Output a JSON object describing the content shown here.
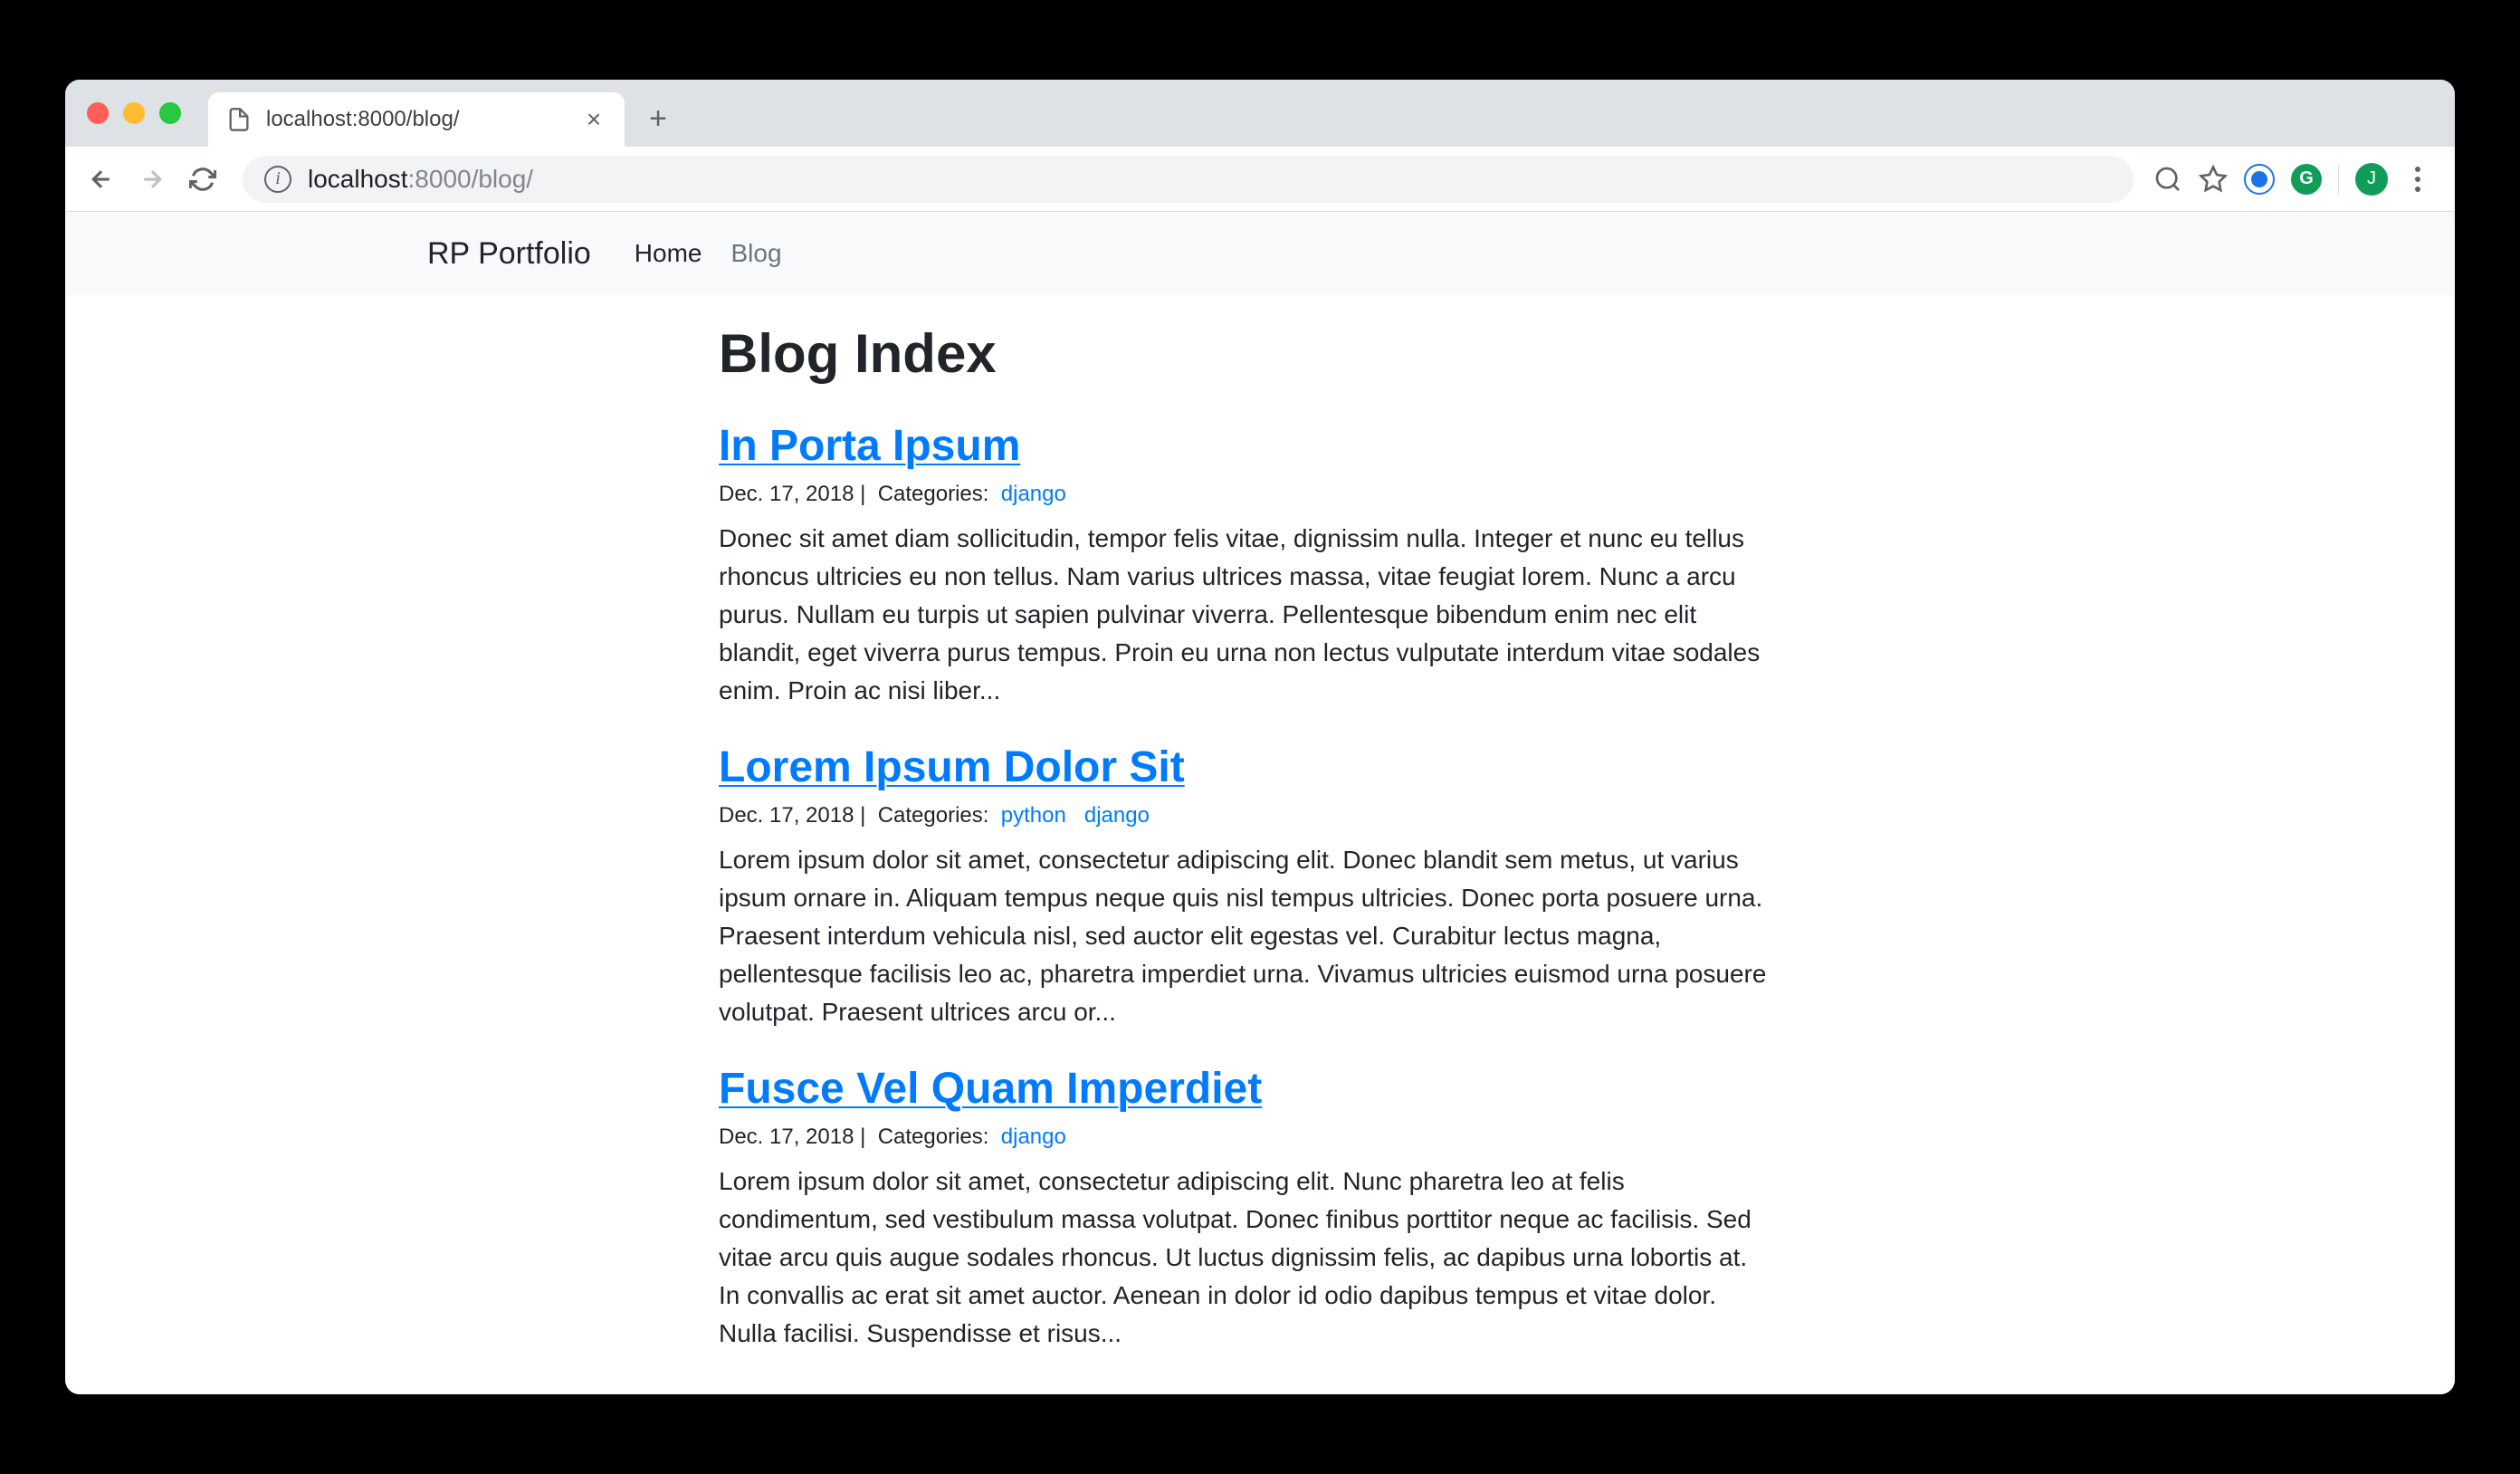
{
  "browser": {
    "tab_title": "localhost:8000/blog/",
    "url_host": "localhost",
    "url_port_path": ":8000/blog/",
    "avatar_initial": "J"
  },
  "navbar": {
    "brand": "RP Portfolio",
    "links": [
      "Home",
      "Blog"
    ],
    "active_index": 1
  },
  "page_title": "Blog Index",
  "meta_labels": {
    "categories": "Categories:"
  },
  "posts": [
    {
      "title": "In Porta Ipsum",
      "date": "Dec. 17, 2018",
      "categories": [
        "django"
      ],
      "body": "Donec sit amet diam sollicitudin, tempor felis vitae, dignissim nulla. Integer et nunc eu tellus rhoncus ultricies eu non tellus. Nam varius ultrices massa, vitae feugiat lorem. Nunc a arcu purus. Nullam eu turpis ut sapien pulvinar viverra. Pellentesque bibendum enim nec elit blandit, eget viverra purus tempus. Proin eu urna non lectus vulputate interdum vitae sodales enim. Proin ac nisi liber..."
    },
    {
      "title": "Lorem Ipsum Dolor Sit",
      "date": "Dec. 17, 2018",
      "categories": [
        "python",
        "django"
      ],
      "body": "Lorem ipsum dolor sit amet, consectetur adipiscing elit. Donec blandit sem metus, ut varius ipsum ornare in. Aliquam tempus neque quis nisl tempus ultricies. Donec porta posuere urna. Praesent interdum vehicula nisl, sed auctor elit egestas vel. Curabitur lectus magna, pellentesque facilisis leo ac, pharetra imperdiet urna. Vivamus ultricies euismod urna posuere volutpat. Praesent ultrices arcu or..."
    },
    {
      "title": "Fusce Vel Quam Imperdiet",
      "date": "Dec. 17, 2018",
      "categories": [
        "django"
      ],
      "body": "Lorem ipsum dolor sit amet, consectetur adipiscing elit. Nunc pharetra leo at felis condimentum, sed vestibulum massa volutpat. Donec finibus porttitor neque ac facilisis. Sed vitae arcu quis augue sodales rhoncus. Ut luctus dignissim felis, ac dapibus urna lobortis at. In convallis ac erat sit amet auctor. Aenean in dolor id odio dapibus tempus et vitae dolor. Nulla facilisi. Suspendisse et risus..."
    }
  ]
}
